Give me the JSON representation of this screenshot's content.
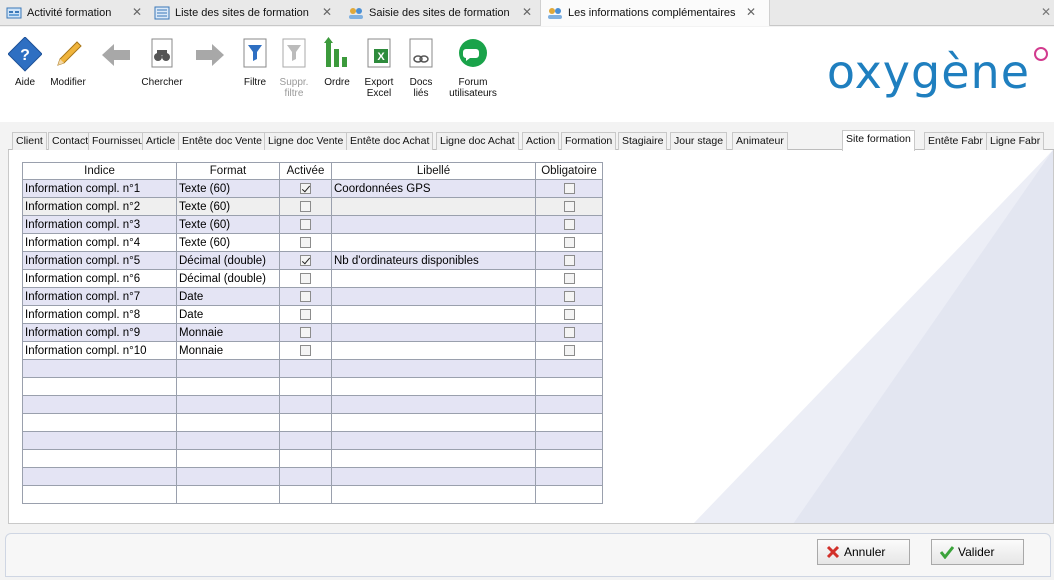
{
  "doc_tabs": [
    {
      "label": "Activité formation",
      "icon": "activity-icon"
    },
    {
      "label": "Liste des sites de formation",
      "icon": "list-icon"
    },
    {
      "label": "Saisie des sites de formation",
      "icon": "people-icon"
    },
    {
      "label": "Les informations complémentaires",
      "icon": "people-icon",
      "active": true
    }
  ],
  "toolbar": {
    "aide": "Aide",
    "modifier": "Modifier",
    "chercher": "Chercher",
    "filtre": "Filtre",
    "suppr_filtre": "Suppr.\nfiltre",
    "ordre": "Ordre",
    "export_excel": "Export\nExcel",
    "docs_lies": "Docs\nliés",
    "forum": "Forum\nutilisateurs"
  },
  "brand": {
    "name": "oxygène",
    "color": "#1f7fbf"
  },
  "module_tabs": [
    "Client",
    "Contact",
    "Fournisseur",
    "Article",
    "Entête doc Vente",
    "Ligne doc Vente",
    "Entête doc Achat",
    "Ligne doc Achat",
    "Action",
    "Formation",
    "Stagiaire",
    "Jour stage",
    "Animateur",
    "Site formation",
    "Entête Fabr",
    "Ligne Fabr"
  ],
  "active_module_tab": "Site formation",
  "grid": {
    "headers": {
      "indice": "Indice",
      "format": "Format",
      "activee": "Activée",
      "libelle": "Libellé",
      "obligatoire": "Obligatoire"
    },
    "rows": [
      {
        "indice": "Information compl. n°1",
        "format": "Texte (60)",
        "activee": true,
        "libelle": "Coordonnées GPS",
        "obligatoire": false
      },
      {
        "indice": "Information compl. n°2",
        "format": "Texte (60)",
        "activee": false,
        "libelle": "",
        "obligatoire": false
      },
      {
        "indice": "Information compl. n°3",
        "format": "Texte (60)",
        "activee": false,
        "libelle": "",
        "obligatoire": false
      },
      {
        "indice": "Information compl. n°4",
        "format": "Texte (60)",
        "activee": false,
        "libelle": "",
        "obligatoire": false
      },
      {
        "indice": "Information compl. n°5",
        "format": "Décimal (double)",
        "activee": true,
        "libelle": "Nb d'ordinateurs disponibles",
        "obligatoire": false
      },
      {
        "indice": "Information compl. n°6",
        "format": "Décimal (double)",
        "activee": false,
        "libelle": "",
        "obligatoire": false
      },
      {
        "indice": "Information compl. n°7",
        "format": "Date",
        "activee": false,
        "libelle": "",
        "obligatoire": false
      },
      {
        "indice": "Information compl. n°8",
        "format": "Date",
        "activee": false,
        "libelle": "",
        "obligatoire": false
      },
      {
        "indice": "Information compl. n°9",
        "format": "Monnaie",
        "activee": false,
        "libelle": "",
        "obligatoire": false
      },
      {
        "indice": "Information compl. n°10",
        "format": "Monnaie",
        "activee": false,
        "libelle": "",
        "obligatoire": false
      }
    ],
    "empty_rows": 8
  },
  "buttons": {
    "annuler": "Annuler",
    "valider": "Valider"
  }
}
